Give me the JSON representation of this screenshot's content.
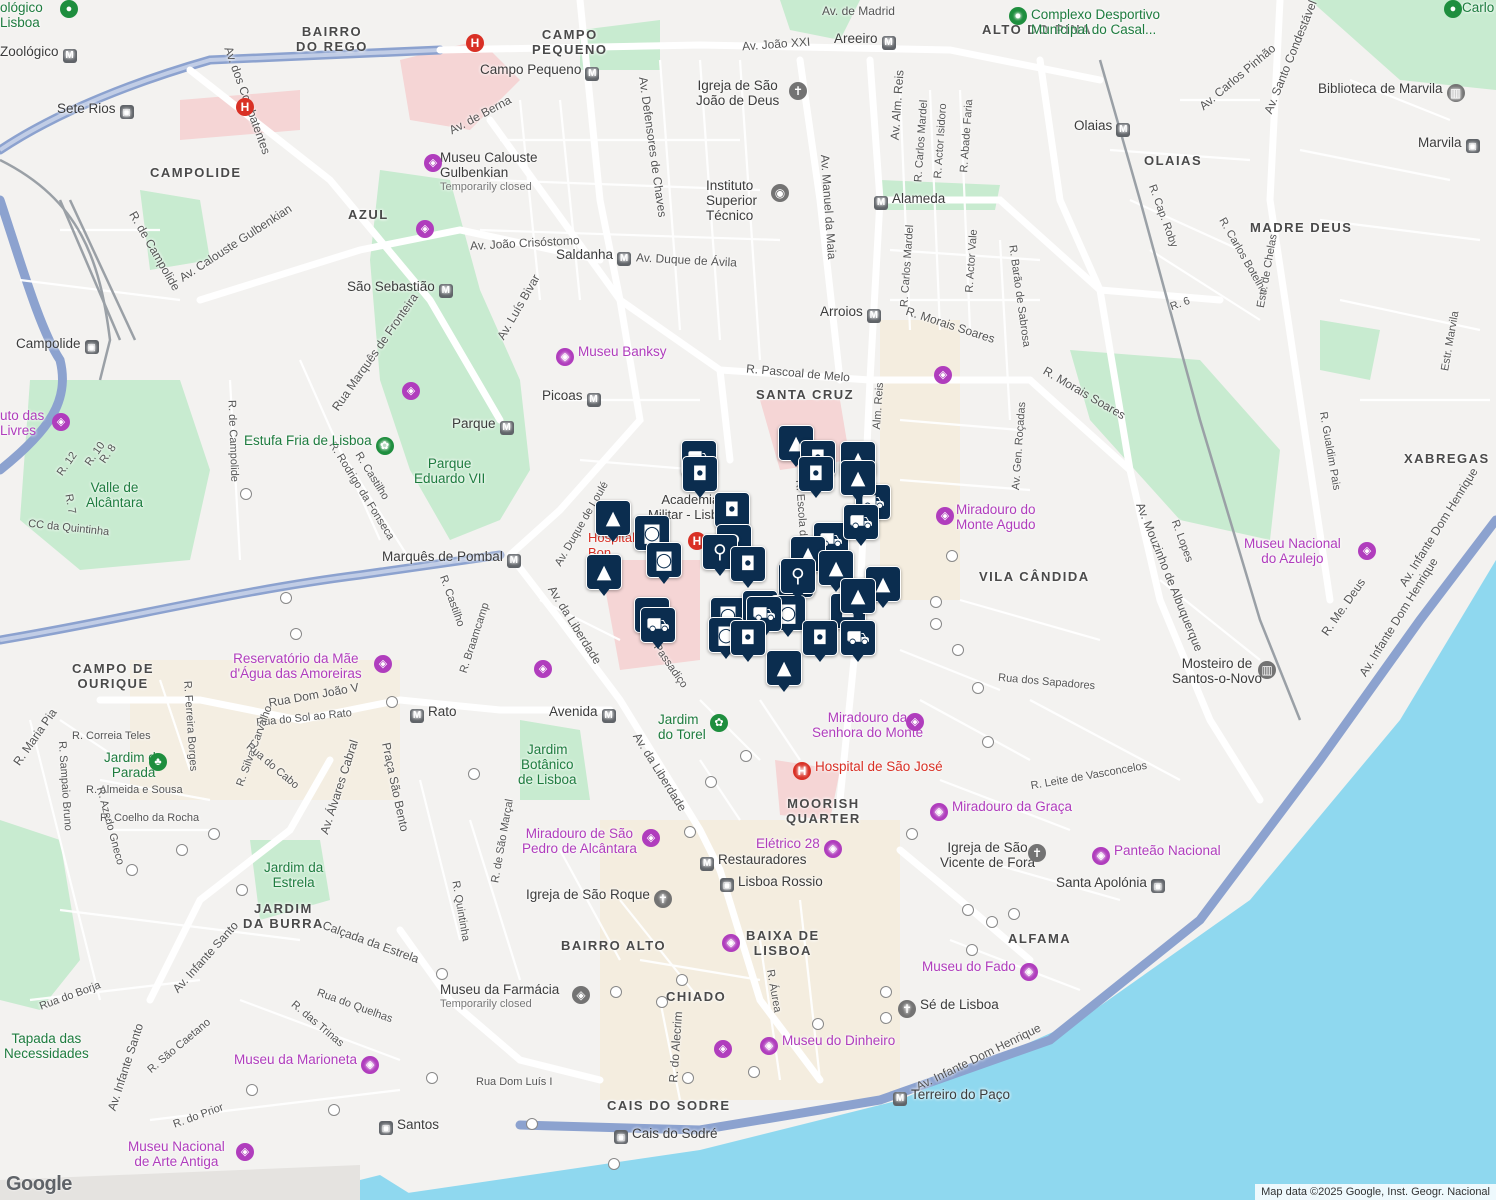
{
  "map": {
    "attribution": "Map data ©2025 Google, Inst. Geogr. Nacional",
    "google_logo": "Google",
    "water_color": "#8fd8ef",
    "land_color": "#f3f2f0",
    "park_color": "#c8ebd0",
    "marker_color": "#0b2d4f"
  },
  "districts": [
    "BAIRRO\nDO REGO",
    "CAMPO\nPEQUENO",
    "ALTO DO PINA",
    "CAMPOLIDE",
    "AZUL",
    "OLAIAS",
    "MADRE DEUS",
    "SANTA CRUZ",
    "XABREGAS",
    "VILA CÂNDIDA",
    "CAMPO DE\nOURIQUE",
    "MOORISH\nQUARTER",
    "JARDIM\nDA BURRA",
    "BAIRRO ALTO",
    "BAIXA DE\nLISBOA",
    "ALFAMA",
    "CHIADO",
    "CAIS DO SODRE"
  ],
  "streets": [
    "Av. dos Combatentes",
    "Av. João XXI",
    "Av. de Madrid",
    "Av. de Berna",
    "Av. Defensores de Chaves",
    "Av. Calouste Gulbenkian",
    "R. de Campolide",
    "Av. João Crisóstomo",
    "Av. Duque de Ávila",
    "Av. Luís Bivar",
    "R. Pascoal de Melo",
    "R. Morais Soares",
    "R. Morais Soares",
    "Av. Manuel da Maia",
    "Av. Alm. Reis",
    "R. Carlos Mardel",
    "R. Actor Isidoro",
    "R. Abade Faria",
    "R. Carlos Mardel",
    "R. Actor Vale",
    "R. Barão de Sabrosa",
    "Av. Gen. Roçadas",
    "R. Cap. Roby",
    "R. Carlos Botelho",
    "R. 6",
    "Estr. de Chelas",
    "Estr. Marvila",
    "R. Gualdim Pais",
    "Av. Mouzinho de Albuquerque",
    "R. Lopes",
    "Av. Carlos Pinhão",
    "Av. Santo Condestável",
    "R. Me. Deus",
    "Av. Infante Dom Henrique",
    "Av. Infante Dom Henrique",
    "Av. Infante Dom Henrique",
    "Av. Duque de Loulé",
    "Rua Marquês de Fronteira",
    "R. de Campolide",
    "R. Rodrigo da Fonseca",
    "R. Castilho",
    "R. Castilho",
    "R. Braamcamp",
    "Av. da Liberdade",
    "Av. da Liberdade",
    "Rua Dom João V",
    "Rua do Sol ao Rato",
    "R. Maria Pia",
    "R. Correia Teles",
    "R. Ferreira Borges",
    "R. Sampaio Bruno",
    "R. Silva Carvalho",
    "Rua do Cabo",
    "R. Almeida e Sousa",
    "R. Azedo Gneco",
    "R. Coelho da Rocha",
    "Av. Álvares Cabral",
    "Praça São Bento",
    "R. de São Marçal",
    "R. Quintinha",
    "Calçada da Estrela",
    "Av. Infante Santo",
    "Rua do Borja",
    "Rua do Quelhas",
    "R. das Trinas",
    "R. São Caetano",
    "R. do Prior",
    "Av. Infante Santo",
    "R. do Alecrim",
    "Rua Dom Luís I",
    "R. Áurea",
    "Rua dos Sapadores",
    "R. Leite de Vasconcelos",
    "R. 10",
    "R. 12",
    "R. 8",
    "R. 7",
    "CC da Quintinha",
    "R. Escola do",
    "Passadiço",
    "Alm. Reis"
  ],
  "stations": [
    {
      "name": "Campo Pequeno",
      "type": "metro"
    },
    {
      "name": "Areeiro",
      "type": "metro"
    },
    {
      "name": "Sete Rios",
      "type": "rail"
    },
    {
      "name": "Olaias",
      "type": "metro"
    },
    {
      "name": "Alameda",
      "type": "metro"
    },
    {
      "name": "Saldanha",
      "type": "metro"
    },
    {
      "name": "São Sebastião",
      "type": "metro"
    },
    {
      "name": "Campolide",
      "type": "rail"
    },
    {
      "name": "Arroios",
      "type": "metro"
    },
    {
      "name": "Picoas",
      "type": "metro"
    },
    {
      "name": "Parque",
      "type": "metro"
    },
    {
      "name": "Marquês de Pombal",
      "type": "metro"
    },
    {
      "name": "Rato",
      "type": "metro"
    },
    {
      "name": "Avenida",
      "type": "metro"
    },
    {
      "name": "Restauradores",
      "type": "metro"
    },
    {
      "name": "Lisboa Rossio",
      "type": "rail"
    },
    {
      "name": "Santa Apolónia",
      "type": "rail"
    },
    {
      "name": "Terreiro do Paço",
      "type": "metro"
    },
    {
      "name": "Cais do Sodré",
      "type": "rail"
    },
    {
      "name": "Santos",
      "type": "rail"
    },
    {
      "name": "Marvila",
      "type": "rail"
    },
    {
      "name": "Zoológico",
      "type": "metro"
    }
  ],
  "pois": [
    {
      "name": "Complexo Desportivo\nMunicipal do Casal...",
      "kind": "park"
    },
    {
      "name": "Biblioteca de Marvila",
      "kind": "library"
    },
    {
      "name": "Igreja de São\nJoão de Deus",
      "kind": "church"
    },
    {
      "name": "Museu Calouste\nGulbenkian",
      "note": "Temporarily closed",
      "kind": "museum"
    },
    {
      "name": "Instituto\nSuperior\nTécnico",
      "kind": "school"
    },
    {
      "name": "Museu Banksy",
      "kind": "museum"
    },
    {
      "name": "Estufa Fria de Lisboa",
      "kind": "park"
    },
    {
      "name": "Parque\nEduardo VII",
      "kind": "park-label"
    },
    {
      "name": "Valle de\nAlcântara",
      "kind": "park-label"
    },
    {
      "name": "uto das\nLivres",
      "kind": "museum"
    },
    {
      "name": "Miradouro do\nMonte Agudo",
      "kind": "museum"
    },
    {
      "name": "Museu Nacional\ndo Azulejo",
      "kind": "museum"
    },
    {
      "name": "Mosteiro de\nSantos-o-Novo",
      "kind": "museum"
    },
    {
      "name": "Reservatório da Mãe\nd'Água das Amoreiras",
      "kind": "museum"
    },
    {
      "name": "Jardim da\nParada",
      "kind": "park"
    },
    {
      "name": "Jardim\ndo Torel",
      "kind": "park"
    },
    {
      "name": "Jardim\nBotânico\nde Lisboa",
      "kind": "park-label"
    },
    {
      "name": "Miradouro da\nSenhora do Monte",
      "kind": "museum"
    },
    {
      "name": "Hospital de São José",
      "kind": "hospital"
    },
    {
      "name": "Miradouro da Graça",
      "kind": "museum"
    },
    {
      "name": "Elétrico 28",
      "kind": "museum"
    },
    {
      "name": "Igreja de São\nVicente de Fora",
      "kind": "church"
    },
    {
      "name": "Panteão Nacional",
      "kind": "museum"
    },
    {
      "name": "Miradouro de São\nPedro de Alcântara",
      "kind": "museum"
    },
    {
      "name": "Jardim da\nEstrela",
      "kind": "park-label"
    },
    {
      "name": "Igreja de São Roque",
      "kind": "church"
    },
    {
      "name": "Museu do Fado",
      "kind": "museum"
    },
    {
      "name": "Museu da Farmácia",
      "note": "Temporarily closed",
      "kind": "museum"
    },
    {
      "name": "Sé de Lisboa",
      "kind": "church"
    },
    {
      "name": "Museu do Dinheiro",
      "kind": "museum"
    },
    {
      "name": "Tapada das\nNecessidades",
      "kind": "park-label"
    },
    {
      "name": "Museu da Marioneta",
      "kind": "museum"
    },
    {
      "name": "Museu Nacional\nde Arte Antiga",
      "kind": "museum"
    },
    {
      "name": "Academia\nMilitar - Lisboa",
      "kind": "label"
    },
    {
      "name": "Hospital\nBon",
      "kind": "hospital-partial"
    },
    {
      "name": "ológico\nLisboa",
      "kind": "park"
    },
    {
      "name": "Carlo",
      "kind": "park"
    }
  ],
  "markers": [
    "shopping-cart",
    "shopping-bag",
    "school",
    "shopping-bag",
    "school",
    "shopping-bag",
    "shopping-cart",
    "school",
    "coffee",
    "school",
    "shopping-bag",
    "coffee",
    "restaurant",
    "restaurant",
    "shopping-bag",
    "school",
    "shopping-cart",
    "shopping-cart",
    "restaurant",
    "school",
    "shopping-cart",
    "coffee",
    "shopping-cart",
    "school",
    "coffee",
    "shopping-bag",
    "coffee",
    "shopping-cart",
    "shopping-bag",
    "shopping-cart",
    "school",
    "school",
    "shopping-cart",
    "restaurant",
    "shopping-bag",
    "school"
  ]
}
